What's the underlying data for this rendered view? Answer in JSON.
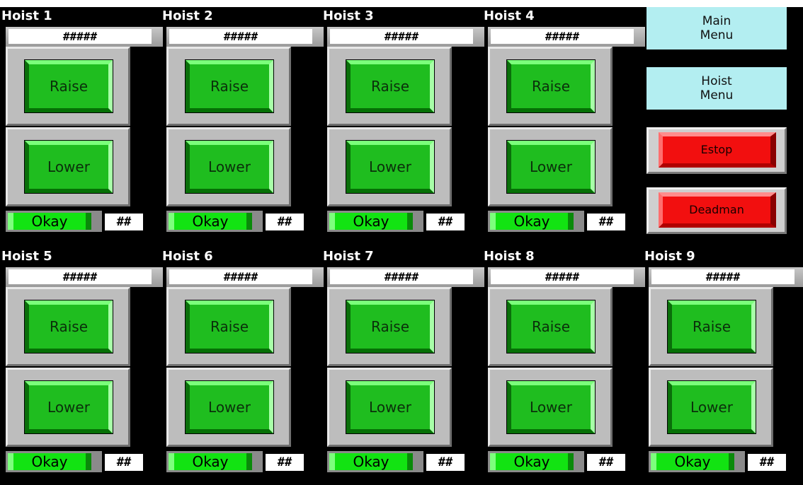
{
  "hoists": [
    {
      "title": "Hoist 1",
      "position": "#####",
      "raise_label": "Raise",
      "lower_label": "Lower",
      "status": "Okay",
      "count": "##"
    },
    {
      "title": "Hoist 2",
      "position": "#####",
      "raise_label": "Raise",
      "lower_label": "Lower",
      "status": "Okay",
      "count": "##"
    },
    {
      "title": "Hoist 3",
      "position": "#####",
      "raise_label": "Raise",
      "lower_label": "Lower",
      "status": "Okay",
      "count": "##"
    },
    {
      "title": "Hoist 4",
      "position": "#####",
      "raise_label": "Raise",
      "lower_label": "Lower",
      "status": "Okay",
      "count": "##"
    },
    {
      "title": "Hoist 5",
      "position": "#####",
      "raise_label": "Raise",
      "lower_label": "Lower",
      "status": "Okay",
      "count": "##"
    },
    {
      "title": "Hoist 6",
      "position": "#####",
      "raise_label": "Raise",
      "lower_label": "Lower",
      "status": "Okay",
      "count": "##"
    },
    {
      "title": "Hoist 7",
      "position": "#####",
      "raise_label": "Raise",
      "lower_label": "Lower",
      "status": "Okay",
      "count": "##"
    },
    {
      "title": "Hoist 8",
      "position": "#####",
      "raise_label": "Raise",
      "lower_label": "Lower",
      "status": "Okay",
      "count": "##"
    },
    {
      "title": "Hoist 9",
      "position": "#####",
      "raise_label": "Raise",
      "lower_label": "Lower",
      "status": "Okay",
      "count": "##"
    }
  ],
  "menu": {
    "main_menu": "Main\nMenu",
    "hoist_menu": "Hoist\nMenu",
    "estop": "Estop",
    "deadman": "Deadman"
  },
  "colors": {
    "background": "#000000",
    "button_green": "#1fbd1f",
    "status_green": "#12e312",
    "menu_cyan": "#b3eef1",
    "alarm_red": "#f20f0f"
  }
}
